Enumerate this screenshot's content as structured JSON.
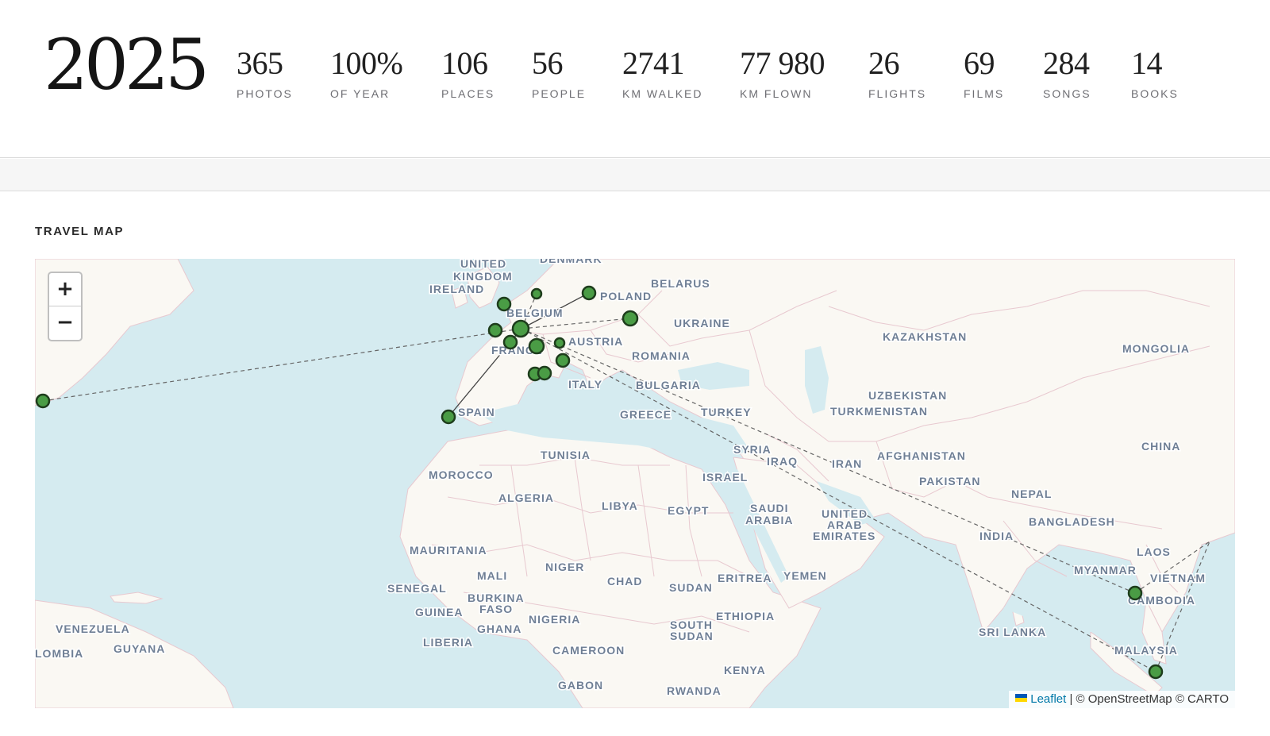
{
  "header": {
    "year": "2025",
    "stats": [
      {
        "value": "365",
        "label": "PHOTOS"
      },
      {
        "value": "100%",
        "label": "OF YEAR"
      },
      {
        "value": "106",
        "label": "PLACES"
      },
      {
        "value": "56",
        "label": "PEOPLE"
      },
      {
        "value": "2741",
        "label": "KM WALKED"
      },
      {
        "value": "77 980",
        "label": "KM FLOWN"
      },
      {
        "value": "26",
        "label": "FLIGHTS"
      },
      {
        "value": "69",
        "label": "FILMS"
      },
      {
        "value": "284",
        "label": "SONGS"
      },
      {
        "value": "14",
        "label": "BOOKS"
      }
    ]
  },
  "travel_map": {
    "title": "TRAVEL MAP",
    "zoom_in": "+",
    "zoom_out": "−",
    "attribution": {
      "leaflet": "Leaflet",
      "rest": "| © OpenStreetMap © CARTO"
    },
    "colors": {
      "water": "#d5ebf0",
      "land": "#faf8f3",
      "border": "#e8c9d0",
      "marker": "#4a9c45",
      "label": "#6f7f95"
    },
    "country_labels": {
      "uk1": "UNITED",
      "uk2": "KINGDOM",
      "denmark": "DENMARK",
      "ireland": "IRELAND",
      "belarus": "BELARUS",
      "poland": "POLAND",
      "belgium": "BELGIUM",
      "ukraine": "UKRAINE",
      "kazakhstan": "KAZAKHSTAN",
      "mongolia": "MONGOLIA",
      "austria": "AUSTRIA",
      "france": "FRANCE",
      "romania": "ROMANIA",
      "italy": "ITALY",
      "bulgaria": "BULGARIA",
      "uzbekistan": "UZBEKISTAN",
      "turkmenistan": "TURKMENISTAN",
      "spain": "SPAIN",
      "greece": "GREECE",
      "turkey": "TURKEY",
      "china": "CHINA",
      "tunisia": "TUNISIA",
      "syria": "SYRIA",
      "iraq": "IRAQ",
      "iran": "IRAN",
      "afghanistan": "AFGHANISTAN",
      "morocco": "MOROCCO",
      "israel": "ISRAEL",
      "pakistan": "PAKISTAN",
      "algeria": "ALGERIA",
      "libya": "LIBYA",
      "egypt": "EGYPT",
      "saudi1": "SAUDI",
      "saudi2": "ARABIA",
      "uae1": "UNITED",
      "uae2": "ARAB",
      "uae3": "EMIRATES",
      "nepal": "NEPAL",
      "bangladesh": "BANGLADESH",
      "india": "INDIA",
      "mauritania": "MAURITANIA",
      "laos": "LAOS",
      "mali": "MALI",
      "niger": "NIGER",
      "myanmar": "MYANMAR",
      "vietnam": "VIETNAM",
      "chad": "CHAD",
      "eritrea": "ERITREA",
      "yemen": "YEMEN",
      "senegal": "SENEGAL",
      "sudan": "SUDAN",
      "cambodia": "CAMBODIA",
      "burkina1": "BURKINA",
      "burkina2": "FASO",
      "guinea": "GUINEA",
      "ethiopia": "ETHIOPIA",
      "nigeria": "NIGERIA",
      "venezuela": "VENEZUELA",
      "ghana": "GHANA",
      "southsudan1": "SOUTH",
      "southsudan2": "SUDAN",
      "srilanka": "SRI LANKA",
      "colombia": "LOMBIA",
      "guyana": "GUYANA",
      "liberia": "LIBERIA",
      "malaysia": "MALAYSIA",
      "cameroon": "CAMEROON",
      "kenya": "KENYA",
      "gabon": "GABON",
      "rwanda": "RWANDA"
    }
  }
}
